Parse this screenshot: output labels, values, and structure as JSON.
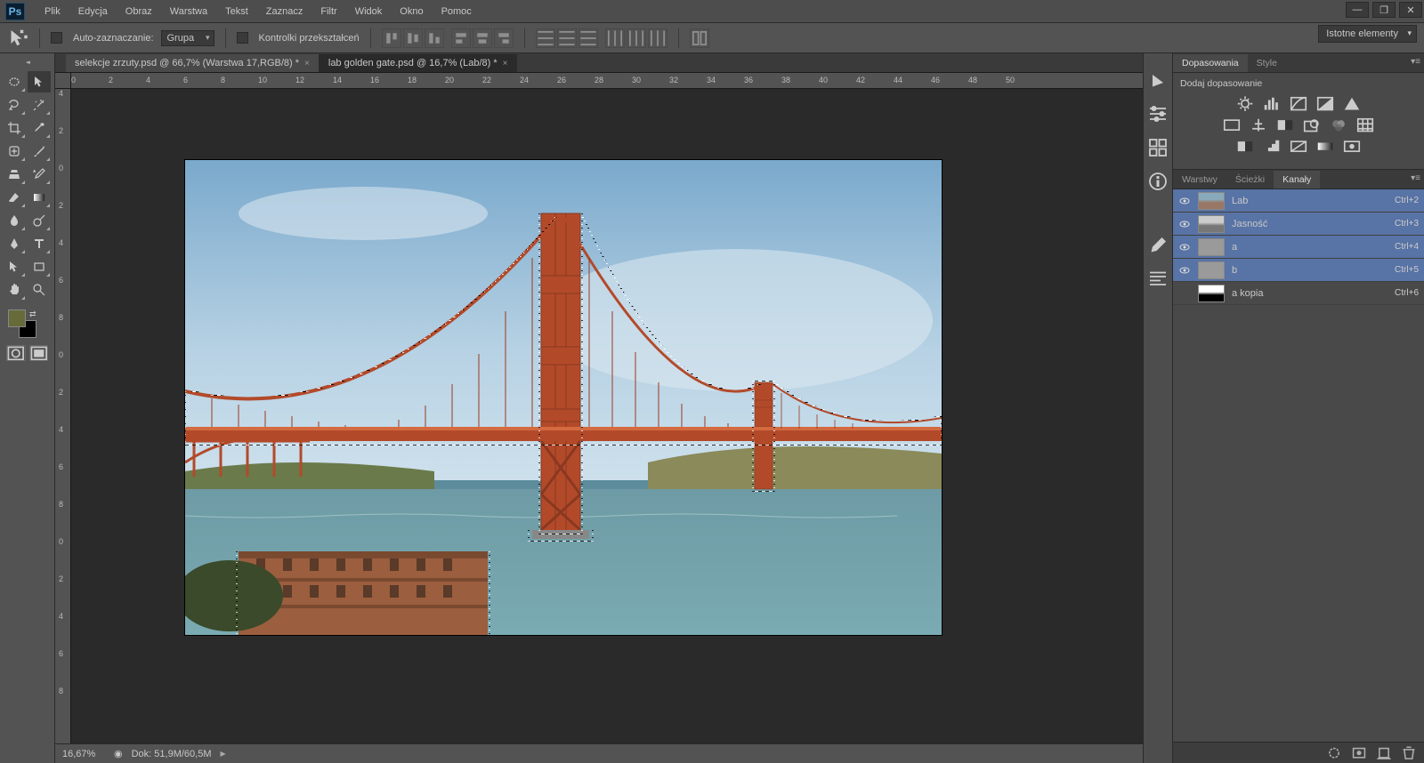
{
  "app": {
    "logo": "Ps"
  },
  "menu": [
    "Plik",
    "Edycja",
    "Obraz",
    "Warstwa",
    "Tekst",
    "Zaznacz",
    "Filtr",
    "Widok",
    "Okno",
    "Pomoc"
  ],
  "window_controls": {
    "min": "—",
    "max": "❐",
    "close": "✕"
  },
  "options_bar": {
    "auto_select_label": "Auto-zaznaczanie:",
    "group_dropdown": "Grupa",
    "transform_label": "Kontrolki przekształceń",
    "workspace_dropdown": "Istotne elementy"
  },
  "tabs": [
    {
      "label": "selekcje zrzuty.psd @ 66,7% (Warstwa 17,RGB/8) *",
      "active": false
    },
    {
      "label": "lab golden gate.psd @ 16,7% (Lab/8) *",
      "active": true
    }
  ],
  "ruler_h": [
    0,
    2,
    4,
    6,
    8,
    10,
    12,
    14,
    16,
    18,
    20,
    22,
    24,
    26,
    28,
    30,
    32,
    34,
    36,
    38,
    40,
    42,
    44,
    46,
    48,
    50
  ],
  "ruler_v": [
    4,
    2,
    0,
    2,
    4,
    6,
    8,
    0,
    2,
    4,
    6,
    8,
    0,
    2,
    4,
    6,
    8
  ],
  "status": {
    "zoom": "16,67%",
    "doc_label": "Dok:",
    "doc_size": "51,9M/60,5M",
    "tri": "▶"
  },
  "colors": {
    "fg": "#676b3a",
    "bg": "#000000"
  },
  "right_mini_icons": [
    "play",
    "slider",
    "swatch",
    "info",
    "brush",
    "para"
  ],
  "panel_group1": {
    "tabs": [
      "Dopasowania",
      "Style"
    ],
    "active": 0
  },
  "panel_group2": {
    "tabs": [
      "Warstwy",
      "Ścieżki",
      "Kanały"
    ],
    "active": 2
  },
  "adjustments": {
    "title": "Dodaj dopasowanie"
  },
  "channels": [
    {
      "name": "Lab",
      "shortcut": "Ctrl+2",
      "visible": true,
      "selected": true,
      "thumb": "color"
    },
    {
      "name": "Jasność",
      "shortcut": "Ctrl+3",
      "visible": true,
      "selected": true,
      "thumb": "gray"
    },
    {
      "name": "a",
      "shortcut": "Ctrl+4",
      "visible": true,
      "selected": true,
      "thumb": "mid"
    },
    {
      "name": "b",
      "shortcut": "Ctrl+5",
      "visible": true,
      "selected": true,
      "thumb": "mid"
    },
    {
      "name": "a kopia",
      "shortcut": "Ctrl+6",
      "visible": false,
      "selected": false,
      "thumb": "bw"
    }
  ]
}
